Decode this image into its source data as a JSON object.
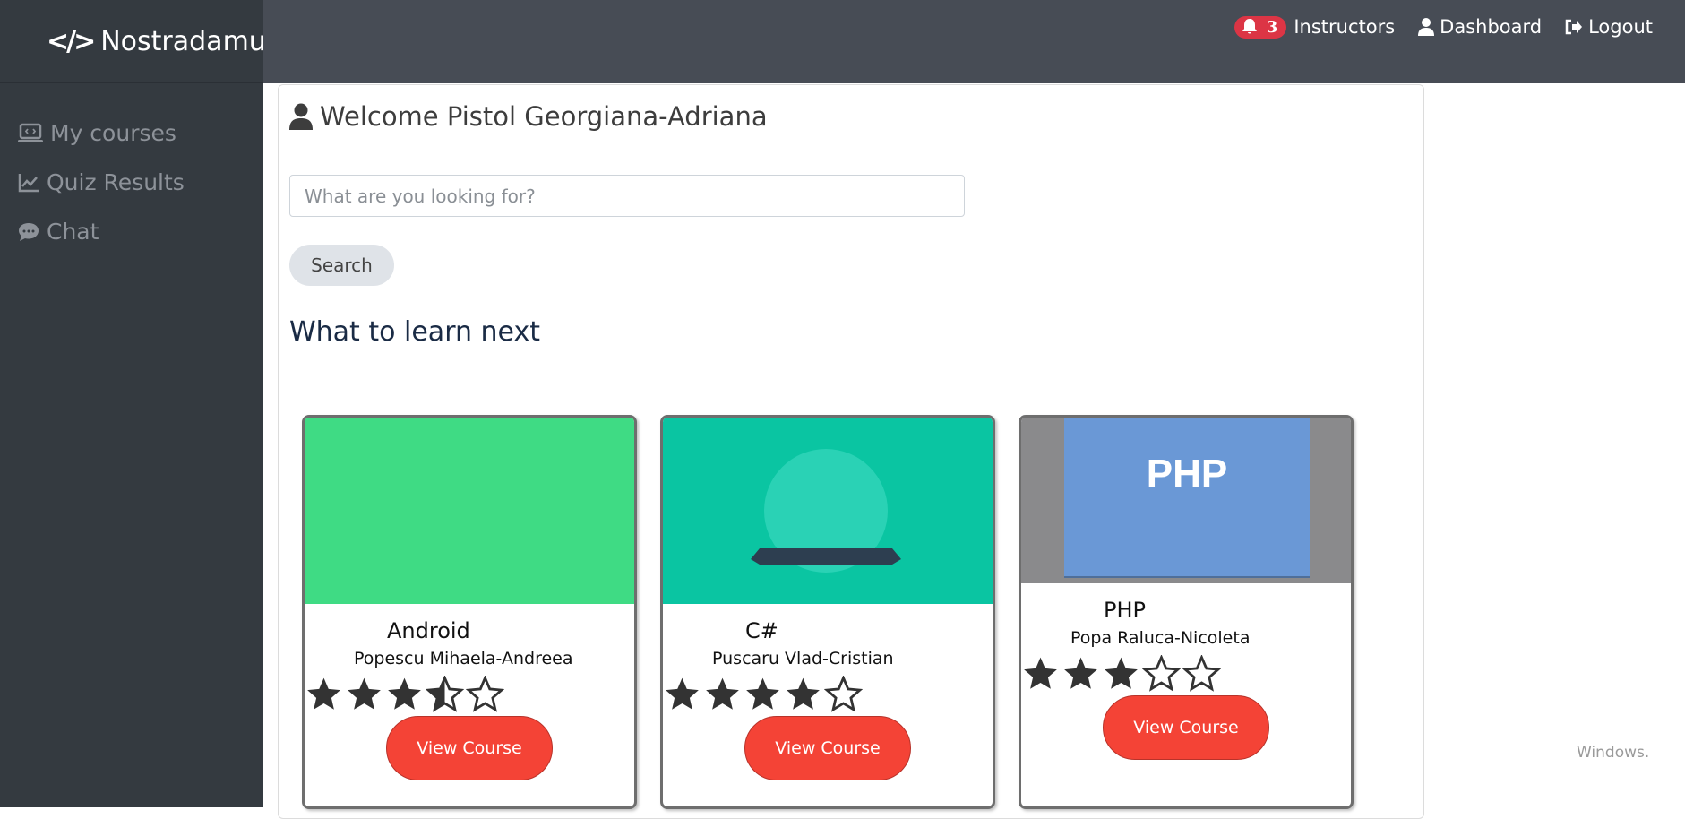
{
  "app": {
    "brand": "Nostradamus"
  },
  "nav": {
    "notification_count": "3",
    "instructors": "Instructors",
    "dashboard": "Dashboard",
    "logout": "Logout"
  },
  "sidebar": {
    "items": [
      {
        "label": "My courses",
        "icon": "laptop-code-icon"
      },
      {
        "label": "Quiz Results",
        "icon": "chart-line-icon"
      },
      {
        "label": "Chat",
        "icon": "comment-dots-icon"
      }
    ]
  },
  "main": {
    "welcome": "Welcome Pistol Georgiana-Adriana",
    "search_placeholder": "What are you looking for?",
    "search_button": "Search",
    "section_title": "What to learn next"
  },
  "courses": [
    {
      "title": "Android",
      "author": "Popescu Mihaela-Andreea",
      "rating": 3.5,
      "button": "View Course",
      "image_bg": "#3fdb84"
    },
    {
      "title": "C#",
      "author": "Puscaru Vlad-Cristian",
      "rating": 4,
      "button": "View Course",
      "image_bg": "#0ac5a2"
    },
    {
      "title": "PHP",
      "author": "Popa Raluca-Nicoleta",
      "rating": 3,
      "button": "View Course",
      "image_bg": "#6a98d6",
      "image_text": "PHP"
    }
  ],
  "watermark": "Windows."
}
